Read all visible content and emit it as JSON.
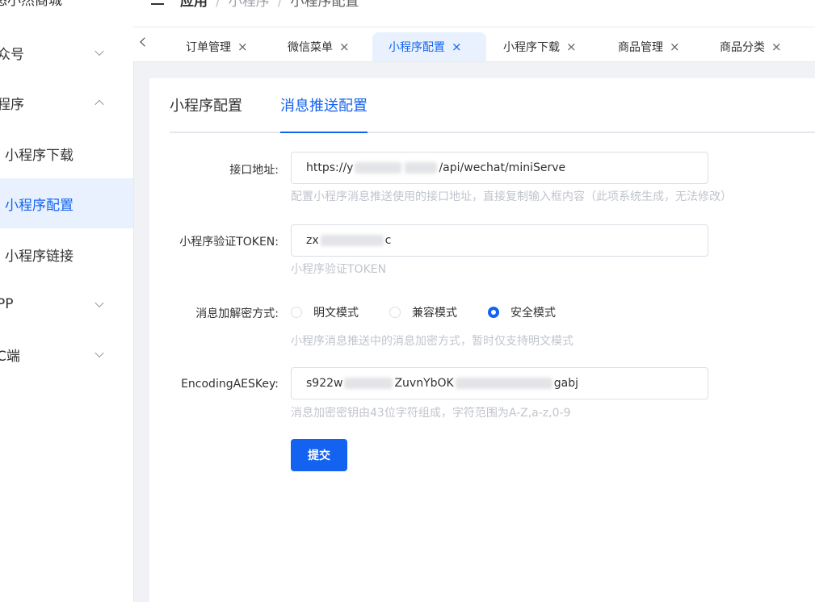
{
  "sidebar": {
    "brand": "悠小然商城",
    "items": [
      {
        "label": "众号",
        "chevron": "chevron-down-icon"
      },
      {
        "label": "程序",
        "chevron": "chevron-up-icon"
      },
      {
        "label": "小程序下载"
      },
      {
        "label": "小程序配置"
      },
      {
        "label": "小程序链接"
      },
      {
        "label": "PP",
        "chevron": "chevron-down-icon"
      },
      {
        "label": "C端",
        "chevron": "chevron-down-icon"
      }
    ]
  },
  "header": {
    "breadcrumb": {
      "root": "应用",
      "sep": "/",
      "middle": "小程序",
      "current": "小程序配置"
    }
  },
  "tabs": {
    "items": [
      {
        "label": "订单管理",
        "close": "×"
      },
      {
        "label": "微信菜单",
        "close": "×"
      },
      {
        "label": "小程序配置",
        "close": "×"
      },
      {
        "label": "小程序下载",
        "close": "×"
      },
      {
        "label": "商品管理",
        "close": "×"
      },
      {
        "label": "商品分类",
        "close": "×"
      }
    ],
    "active_index": 2
  },
  "content_tabs": [
    "小程序配置",
    "消息推送配置"
  ],
  "form": {
    "url": {
      "label": "接口地址:",
      "value_prefix": "https://y",
      "value_suffix": "/api/wechat/miniServe",
      "hint": "配置小程序消息推送使用的接口地址，直接复制输入框内容（此项系统生成，无法修改）"
    },
    "token": {
      "label": "小程序验证TOKEN:",
      "value_prefix": "zx",
      "value_suffix": "c",
      "hint": "小程序验证TOKEN"
    },
    "encrypt": {
      "label": "消息加解密方式:",
      "options": [
        "明文模式",
        "兼容模式",
        "安全模式"
      ],
      "selected": "安全模式",
      "hint": "小程序消息推送中的消息加密方式，暂时仅支持明文模式"
    },
    "aes": {
      "label": "EncodingAESKey:",
      "value_prefix": "s922w",
      "value_mid": "ZuvnYbOK",
      "value_suffix": "gabj",
      "hint": "消息加密密钥由43位字符组成，字符范围为A-Z,a-z,0-9"
    },
    "submit": "提交"
  },
  "colors": {
    "accent": "#1463f0",
    "active_bg": "#e8f1fd",
    "hint": "#c0c4cc"
  }
}
